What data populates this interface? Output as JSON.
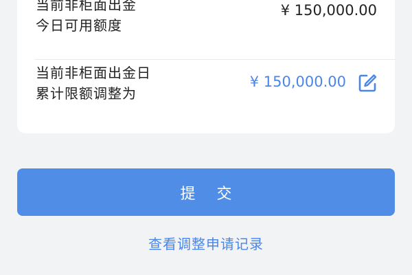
{
  "limits": {
    "today_available": {
      "label_line1": "当前非柜面出金",
      "label_line2": "今日可用额度",
      "value": "¥ 150,000.00"
    },
    "adjust_to": {
      "label_line1": "当前非柜面出金日",
      "label_line2": "累计限额调整为",
      "value": "¥ 150,000.00",
      "icon": "edit-icon"
    }
  },
  "actions": {
    "submit_label": "提 交",
    "history_link": "查看调整申请记录"
  },
  "colors": {
    "accent": "#4a86e8",
    "button": "#4f8de6",
    "background": "#f2f3f5",
    "text": "#222222"
  }
}
